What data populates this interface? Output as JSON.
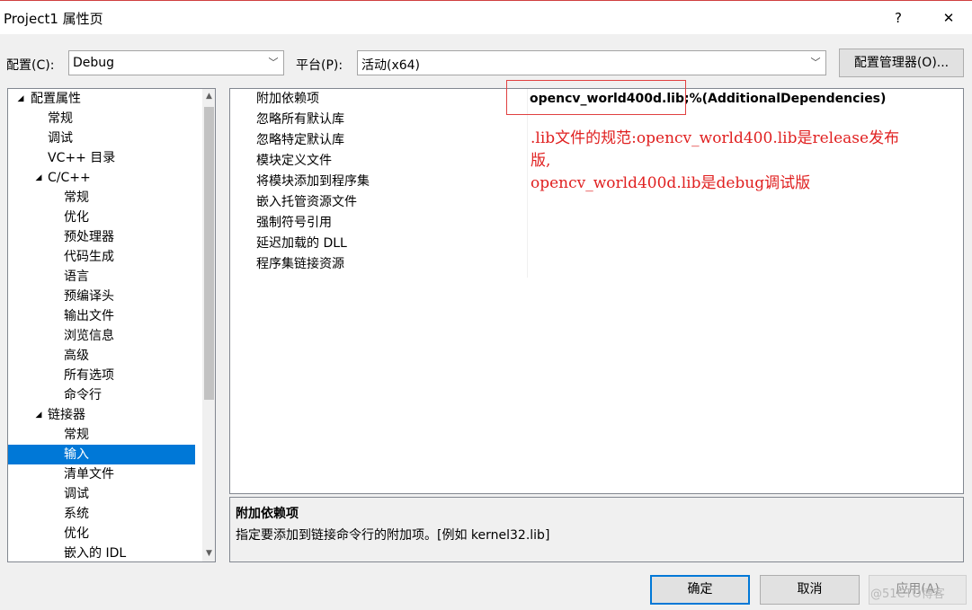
{
  "window": {
    "title": "Project1 属性页",
    "help_glyph": "?",
    "close_glyph": "✕"
  },
  "toolbar": {
    "config_label": "配置(C):",
    "config_value": "Debug",
    "platform_label": "平台(P):",
    "platform_value": "活动(x64)",
    "config_manager_label": "配置管理器(O)..."
  },
  "tree": {
    "items": [
      {
        "label": "配置属性",
        "expand": "◢"
      },
      {
        "label": "常规"
      },
      {
        "label": "调试"
      },
      {
        "label": "VC++ 目录"
      },
      {
        "label": "C/C++",
        "expand": "◢"
      },
      {
        "label": "常规"
      },
      {
        "label": "优化"
      },
      {
        "label": "预处理器"
      },
      {
        "label": "代码生成"
      },
      {
        "label": "语言"
      },
      {
        "label": "预编译头"
      },
      {
        "label": "输出文件"
      },
      {
        "label": "浏览信息"
      },
      {
        "label": "高级"
      },
      {
        "label": "所有选项"
      },
      {
        "label": "命令行"
      },
      {
        "label": "链接器",
        "expand": "◢"
      },
      {
        "label": "常规"
      },
      {
        "label": "输入",
        "selected": true
      },
      {
        "label": "清单文件"
      },
      {
        "label": "调试"
      },
      {
        "label": "系统"
      },
      {
        "label": "优化"
      },
      {
        "label": "嵌入的 IDL"
      }
    ]
  },
  "grid": {
    "rows": [
      {
        "name": "附加依赖项",
        "value": "opencv_world400d.lib;%(AdditionalDependencies)"
      },
      {
        "name": "忽略所有默认库",
        "value": ""
      },
      {
        "name": "忽略特定默认库",
        "value": ""
      },
      {
        "name": "模块定义文件",
        "value": ""
      },
      {
        "name": "将模块添加到程序集",
        "value": ""
      },
      {
        "name": "嵌入托管资源文件",
        "value": ""
      },
      {
        "name": "强制符号引用",
        "value": ""
      },
      {
        "name": "延迟加载的 DLL",
        "value": ""
      },
      {
        "name": "程序集链接资源",
        "value": ""
      }
    ]
  },
  "annotation": {
    "line1": ".lib文件的规范:opencv_world400.lib是release发布",
    "line2": "版,",
    "line3": "opencv_world400d.lib是debug调试版",
    "color": "#e02020"
  },
  "description": {
    "title": "附加依赖项",
    "text": "指定要添加到链接命令行的附加项。[例如 kernel32.lib]"
  },
  "buttons": {
    "ok": "确定",
    "cancel": "取消",
    "apply": "应用(A)"
  },
  "watermark": "@51CTO博客"
}
